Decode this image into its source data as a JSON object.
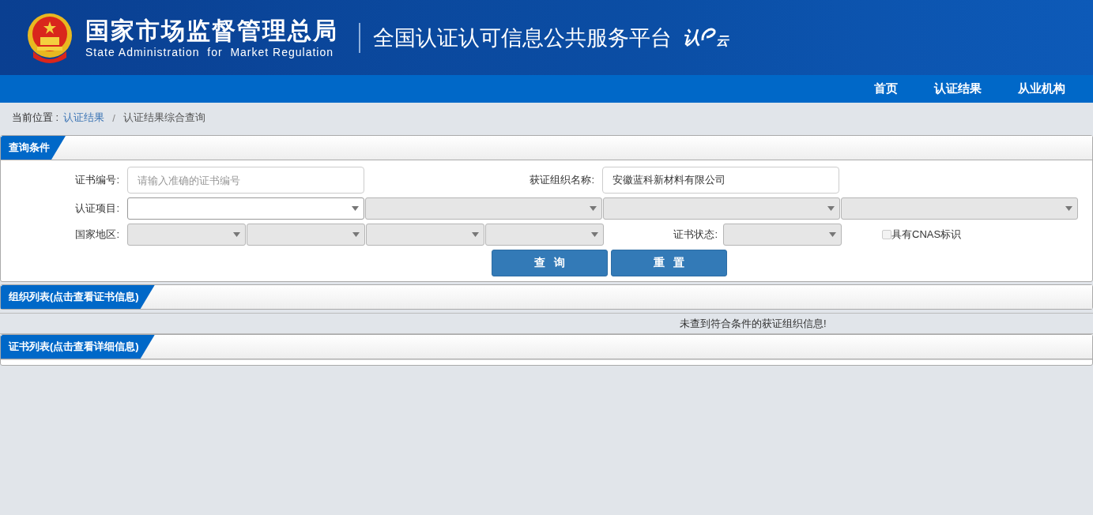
{
  "header": {
    "agency_name": "国家市场监督管理总局",
    "agency_name_en": "State Administration  for  Market Regulation",
    "platform_name": "全国认证认可信息公共服务平台",
    "logo_text": [
      "认",
      "云"
    ]
  },
  "nav": {
    "items": [
      {
        "label": "首页"
      },
      {
        "label": "认证结果"
      },
      {
        "label": "从业机构"
      }
    ]
  },
  "breadcrumb": {
    "prefix": "当前位置 :",
    "items": [
      "认证结果",
      "认证结果综合查询"
    ],
    "separator": "/"
  },
  "query_panel": {
    "title": "查询条件",
    "certificate_number": {
      "label": "证书编号:",
      "placeholder": "请输入准确的证书编号"
    },
    "organization_name": {
      "label": "获证组织名称:",
      "value": "安徽蓝科新材料有限公司"
    },
    "certification_project": {
      "label": "认证项目:",
      "selects": [
        {
          "disabled": false
        },
        {
          "disabled": true
        },
        {
          "disabled": true
        },
        {
          "disabled": true
        }
      ]
    },
    "country_region": {
      "label": "国家地区:",
      "selects": [
        {
          "disabled": true
        },
        {
          "disabled": true
        },
        {
          "disabled": true
        },
        {
          "disabled": true
        }
      ]
    },
    "certificate_status": {
      "label": "证书状态:",
      "select": {
        "disabled": true
      }
    },
    "cnas_mark": {
      "label": "具有CNAS标识",
      "checked": false
    },
    "buttons": [
      "查询",
      "重置"
    ]
  },
  "organization_panel": {
    "title": "组织列表(点击查看证书信息)",
    "message": "未查到符合条件的获证组织信息!"
  },
  "certificate_panel": {
    "title": "证书列表(点击查看详细信息)"
  }
}
